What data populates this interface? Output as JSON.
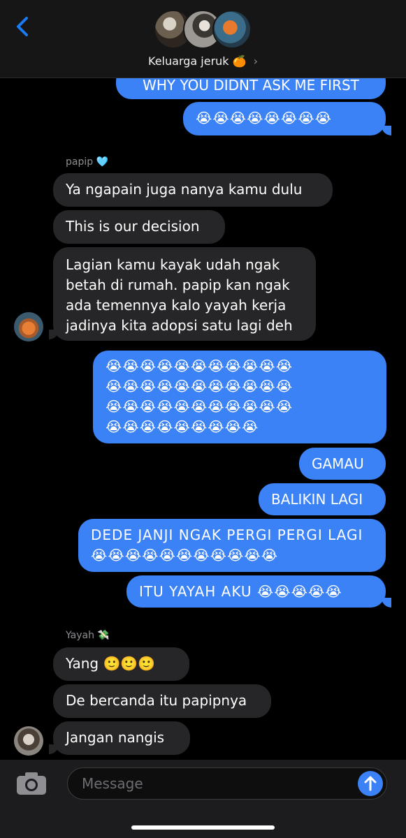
{
  "header": {
    "group_name": "Keluarga jeruk 🍊",
    "chevron": "›"
  },
  "messages": {
    "m0": "WHY YOU DIDNT ASK ME FIRST",
    "m1": "😭😭😭😭😭😭😭😭",
    "sender_papip": "papip 🩵",
    "m2": "Ya ngapain juga nanya kamu dulu",
    "m3": "This is our decision",
    "m4": "Lagian kamu kayak udah ngak\nbetah di rumah. papip kan ngak\nada temennya kalo yayah kerja\njadinya kita adopsi satu lagi deh",
    "m5": "😭😭😭😭😭😭😭😭😭😭😭\n😭😭😭😭😭😭😭😭😭😭😭\n😭😭😭😭😭😭😭😭😭😭😭\n😭😭😭😭😭😭😭😭😭",
    "m6": "GAMAU",
    "m7": "BALIKIN LAGI",
    "m8": "DEDE JANJI NGAK PERGI PERGI LAGI\n😭😭😭😭😭😭😭😭😭😭😭",
    "m9": "ITU YAYAH AKU 😭😭😭😭😭",
    "sender_yayah": "Yayah 💸",
    "m10": "Yang 🙂🙂🙂",
    "m11": "De bercanda itu papipnya",
    "m12": "Jangan nangis"
  },
  "compose": {
    "placeholder": "Message"
  },
  "colors": {
    "outgoing": "#3b82f6",
    "incoming": "#262628",
    "accent": "#1a7cf5"
  },
  "icons": [
    "chevron-left-icon",
    "camera-icon",
    "arrow-up-icon"
  ]
}
